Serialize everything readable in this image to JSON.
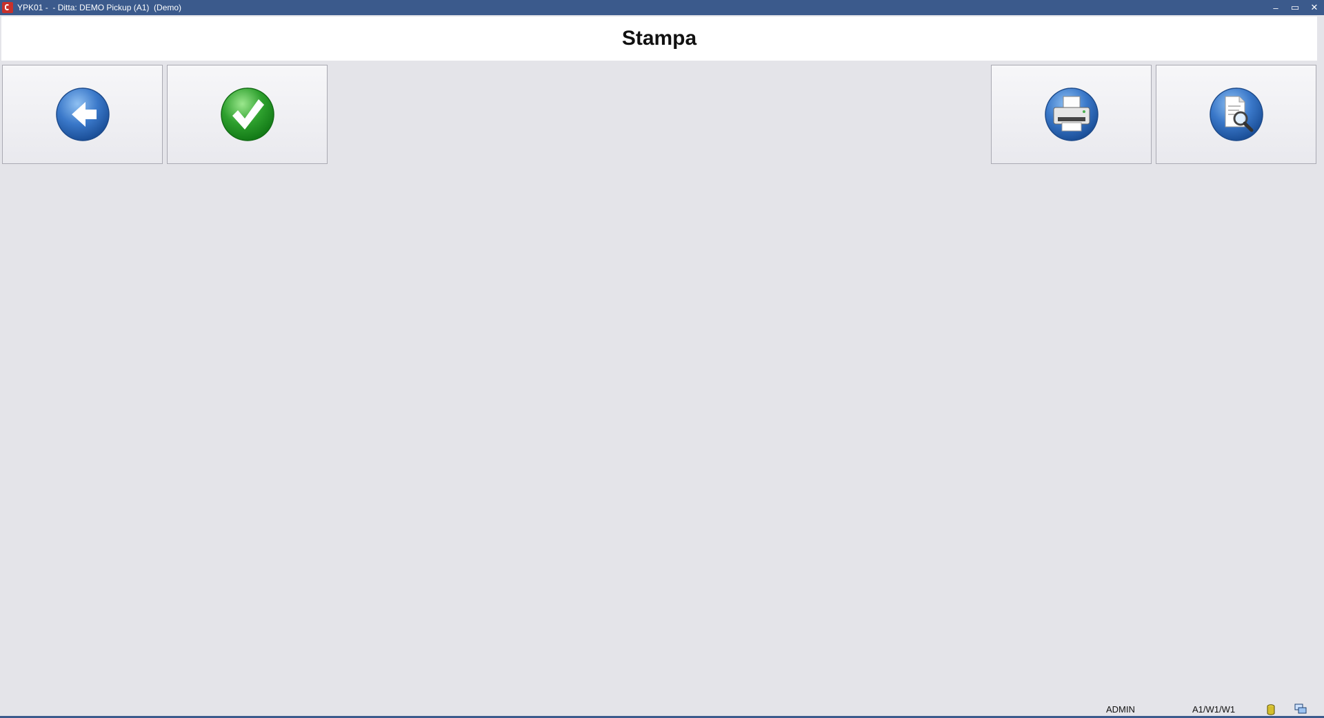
{
  "window": {
    "title": "YPK01 -  - Ditta: DEMO Pickup (A1)  (Demo)",
    "controls": {
      "minimize": "–",
      "restore": "▭",
      "close": "✕"
    }
  },
  "header": {
    "title": "Stampa"
  },
  "toolbar": {
    "left": [
      {
        "name": "back",
        "icon": "back-arrow-icon"
      },
      {
        "name": "confirm",
        "icon": "checkmark-icon"
      }
    ],
    "right": [
      {
        "name": "print",
        "icon": "printer-icon"
      },
      {
        "name": "preview",
        "icon": "print-preview-icon"
      }
    ]
  },
  "status": {
    "user": "ADMIN",
    "location": "A1/W1/W1",
    "icons": [
      "database-icon",
      "network-icon"
    ]
  },
  "colors": {
    "titlebar": "#3b5a8c",
    "background": "#e4e4e9",
    "blue_button": "#3a78c9",
    "green_button": "#2ea02e"
  }
}
